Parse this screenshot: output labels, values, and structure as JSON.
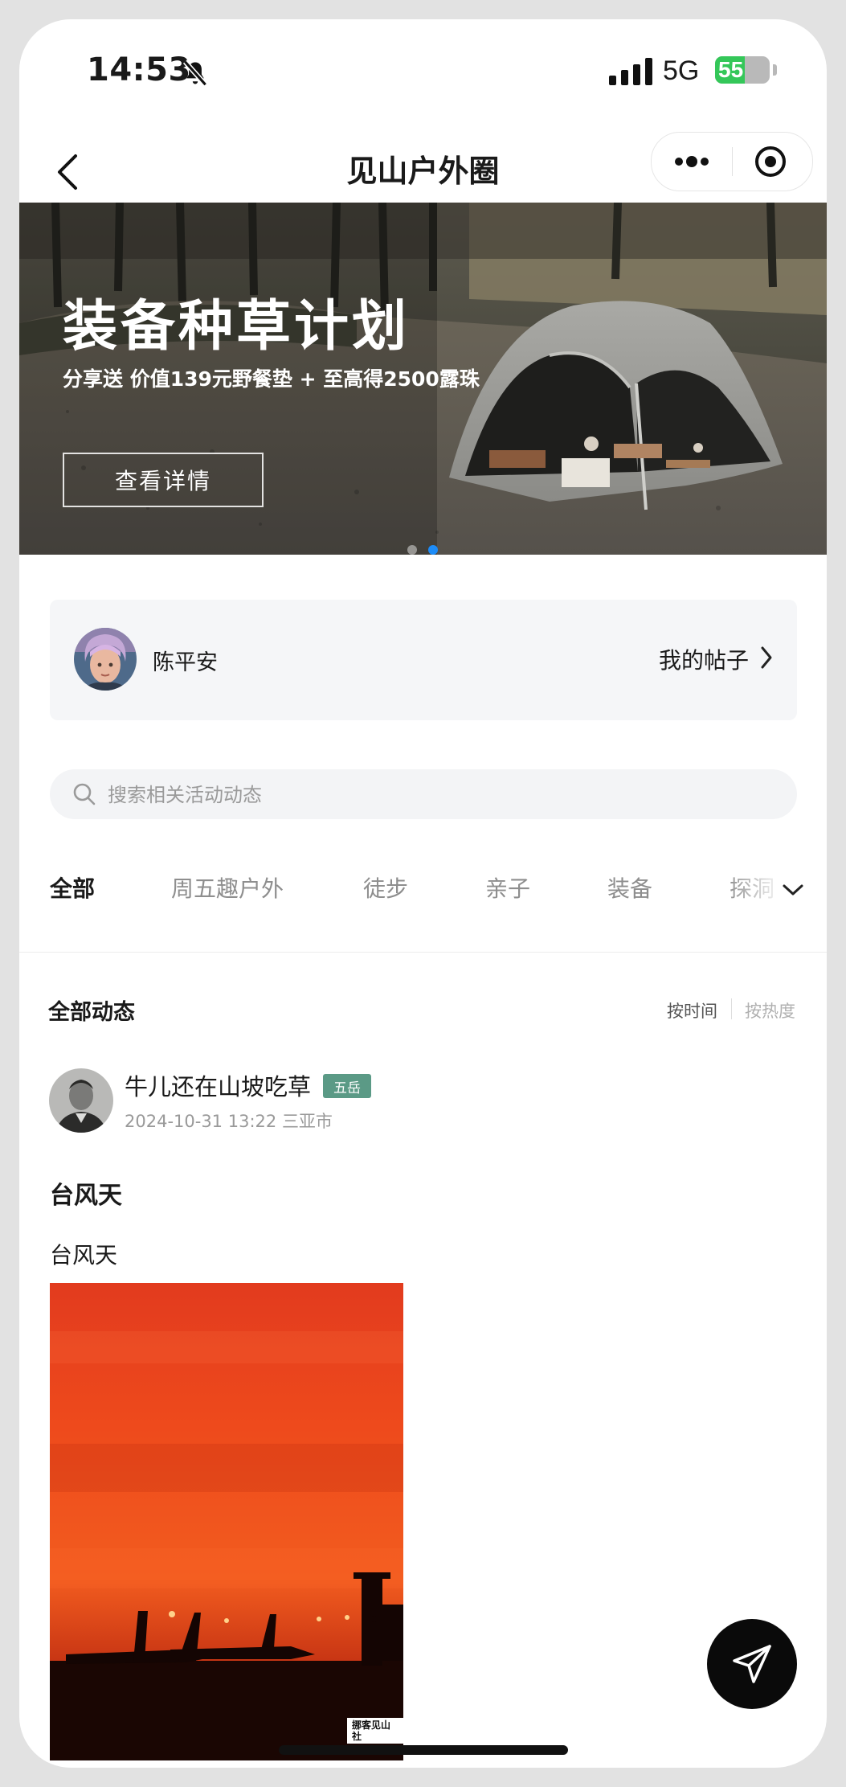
{
  "status_bar": {
    "time": "14:53",
    "network": "5G",
    "battery_text": "55",
    "battery_level": 0.55,
    "battery_color": "#34c759"
  },
  "nav": {
    "title": "见山户外圈",
    "back_icon": "chevron-left-icon",
    "more_icon": "more-dots-icon",
    "close_icon": "target-circle-icon"
  },
  "banner": {
    "headline": "装备种草计划",
    "subline": "分享送 价值139元野餐垫 + 至高得2500露珠",
    "button_label": "查看详情",
    "slide_count": 2,
    "active_slide": 2,
    "dot_active_color": "#1d8cf8"
  },
  "user": {
    "name": "陈平安",
    "my_posts_label": "我的帖子"
  },
  "search": {
    "placeholder": "搜索相关活动动态",
    "value": ""
  },
  "tabs": [
    {
      "label": "全部",
      "active": true
    },
    {
      "label": "周五趣户外",
      "active": false
    },
    {
      "label": "徒步",
      "active": false
    },
    {
      "label": "亲子",
      "active": false
    },
    {
      "label": "装备",
      "active": false
    },
    {
      "label": "探洞",
      "active": false
    }
  ],
  "feed": {
    "title": "全部动态",
    "sort_time": "按时间",
    "sort_hot": "按热度"
  },
  "post": {
    "author": "牛儿还在山坡吃草",
    "badge": "五岳",
    "badge_color": "#5b9a86",
    "timestamp": "2024-10-31 13:22",
    "location": "三亚市",
    "title": "台风天",
    "text": "台风天",
    "image_label": "挪客见山社"
  },
  "fab": {
    "icon": "send-paper-plane-icon"
  }
}
